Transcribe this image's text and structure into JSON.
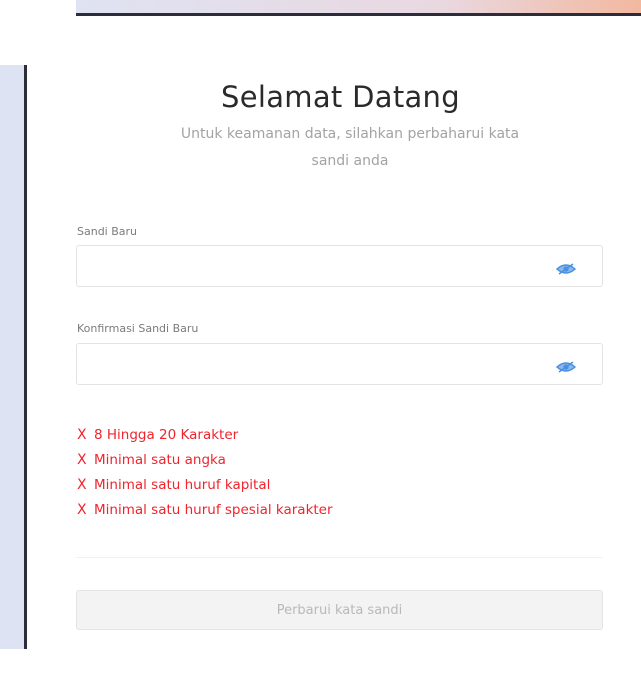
{
  "header": {
    "title": "Selamat Datang",
    "subtitle_line1": "Untuk keamanan data, silahkan perbaharui kata",
    "subtitle_line2": "sandi anda"
  },
  "form": {
    "new_password": {
      "label": "Sandi Baru",
      "value": ""
    },
    "confirm_password": {
      "label": "Konfirmasi Sandi Baru",
      "value": ""
    },
    "eye_icon": "eye-icon"
  },
  "rules": [
    {
      "text": "8 Hingga 20 Karakter",
      "status": "unmet"
    },
    {
      "text": "Minimal satu angka",
      "status": "unmet"
    },
    {
      "text": "Minimal satu huruf kapital",
      "status": "unmet"
    },
    {
      "text": "Minimal satu huruf spesial karakter",
      "status": "unmet"
    }
  ],
  "rule_mark": "X",
  "submit_label": "Perbarui kata sandi",
  "colors": {
    "error": "#f0242d",
    "eye_icon": "#4a90e2",
    "button_bg": "#f3f3f3",
    "title": "#2a2a2a",
    "subtitle": "#a3a3a3"
  }
}
